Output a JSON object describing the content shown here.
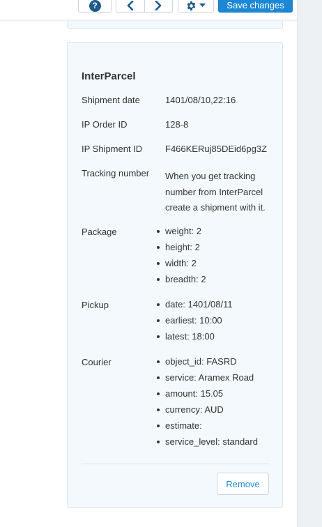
{
  "toolbar": {
    "help_icon": "question-circle-icon",
    "prev_icon": "chevron-left-icon",
    "next_icon": "chevron-right-icon",
    "settings_icon": "gear-icon",
    "dropdown_icon": "caret-down-icon",
    "save_label": "Save changes",
    "accent_color": "#1d87d5"
  },
  "card": {
    "title": "InterParcel",
    "rows": [
      {
        "label": "Shipment date",
        "value": "1401/08/10,22:16"
      },
      {
        "label": "IP Order ID",
        "value": "128-8"
      },
      {
        "label": "IP Shipment ID",
        "value": "F466KERuj85DEid6pg3Z"
      },
      {
        "label": "Tracking number",
        "value": "When you get tracking number from InterParcel create a shipment with it."
      }
    ],
    "package": {
      "label": "Package",
      "items": [
        "weight: 2",
        "height: 2",
        "width: 2",
        "breadth: 2"
      ]
    },
    "pickup": {
      "label": "Pickup",
      "items": [
        "date: 1401/08/11",
        "earliest: 10:00",
        "latest: 18:00"
      ]
    },
    "courier": {
      "label": "Courier",
      "items": [
        "object_id: FASRD",
        "service: Aramex Road",
        "amount: 15.05",
        "currency: AUD",
        "estimate:",
        "service_level: standard"
      ]
    },
    "remove_label": "Remove"
  }
}
